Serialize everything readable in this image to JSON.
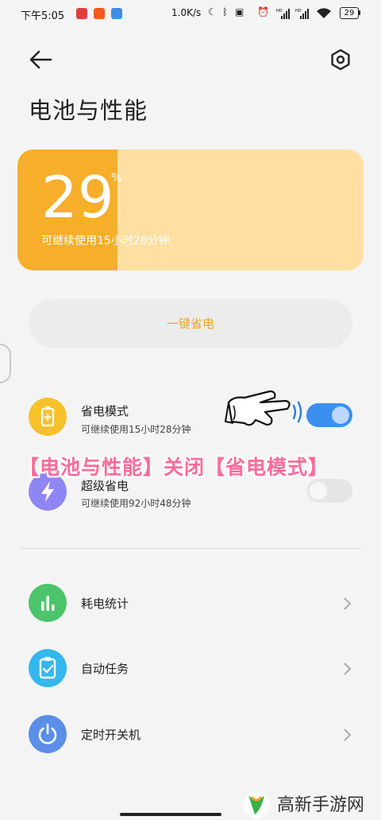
{
  "status_bar": {
    "time": "下午5:05",
    "network_speed": "1.0K/s",
    "battery_level": "29",
    "icons": [
      "netease-music-icon",
      "app-icon",
      "calendar-app-icon",
      "moon-icon",
      "bluetooth-icon",
      "vibrate-icon",
      "alarm-icon",
      "signal-icon",
      "signal-icon",
      "wifi-icon",
      "battery-icon"
    ],
    "hd_label": "HD"
  },
  "header": {
    "title": "电池与性能",
    "back_icon": "back-arrow-icon",
    "settings_icon": "hexagon-gear-icon"
  },
  "battery_card": {
    "percent": "29",
    "percent_sign": "%",
    "fill_fraction": 0.29,
    "remaining": "可继续使用15小时28分钟",
    "fill_color": "#f6ae2b",
    "track_color": "#ffdfa2"
  },
  "one_key_save": {
    "label": "一键省电"
  },
  "modes": [
    {
      "title": "省电模式",
      "subtitle": "可继续使用15小时28分钟",
      "icon": "battery-plus-icon",
      "icon_color": "#f7c12c",
      "enabled": true
    },
    {
      "title": "超级省电",
      "subtitle": "可继续使用92小时48分钟",
      "icon": "lightning-icon",
      "icon_color": "#8f86f5",
      "enabled": false
    }
  ],
  "overlay_caption": "【电池与性能】关闭【省电模式】",
  "features": [
    {
      "label": "耗电统计",
      "icon": "bar-chart-icon",
      "icon_color": "#4cc46b"
    },
    {
      "label": "自动任务",
      "icon": "clipboard-check-icon",
      "icon_color": "#33b7ee"
    },
    {
      "label": "定时开关机",
      "icon": "power-icon",
      "icon_color": "#5b8ee6"
    }
  ],
  "watermark": {
    "text": "高新手游网"
  },
  "colors": {
    "accent": "#f6ae2b",
    "toggle_on": "#3a8ff0",
    "toggle_off": "#e6e6e6"
  }
}
